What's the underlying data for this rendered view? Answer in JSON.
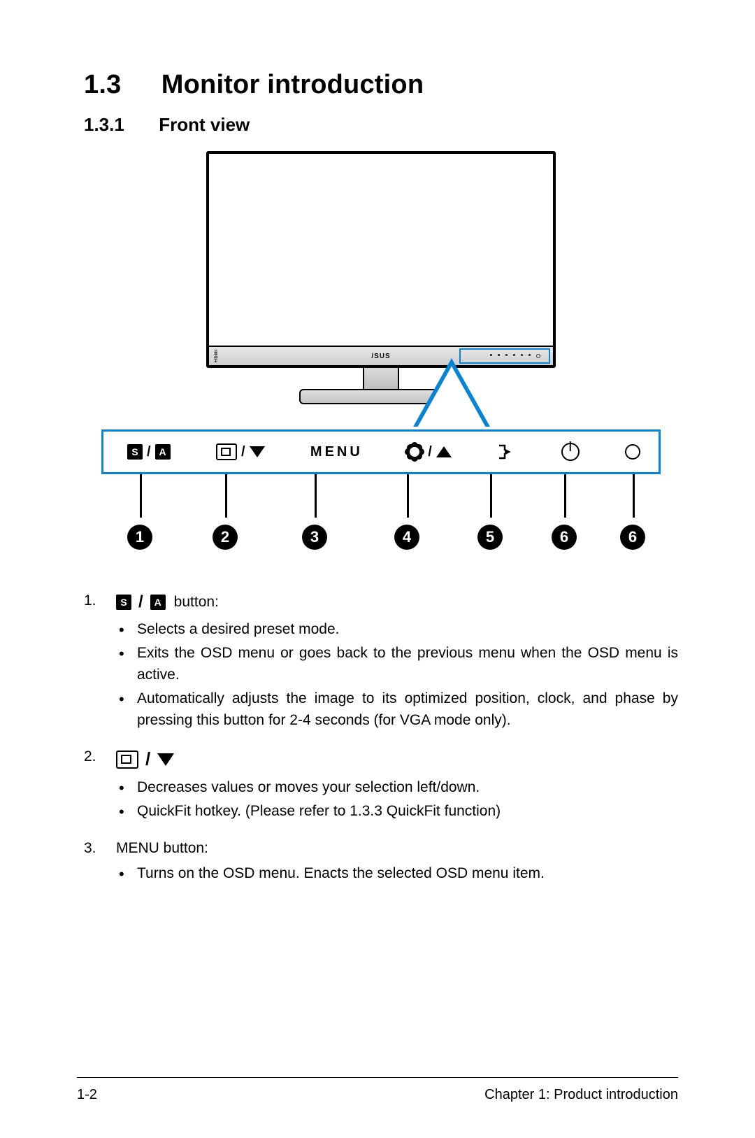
{
  "section": {
    "number": "1.3",
    "title": "Monitor introduction"
  },
  "subsection": {
    "number": "1.3.1",
    "title": "Front view"
  },
  "monitor": {
    "logo_text": "/SUS",
    "port_label": "HDMI"
  },
  "strip": {
    "cell1_s": "S",
    "cell1_a": "A",
    "cell3_menu": "MENU"
  },
  "callouts": [
    "1",
    "2",
    "3",
    "4",
    "5",
    "6",
    "6"
  ],
  "list": {
    "item1": {
      "n": "1.",
      "icon_s": "S",
      "icon_a": "A",
      "head_tail": "button:",
      "b1": "Selects a desired preset mode.",
      "b2": "Exits the OSD menu or goes back to the previous menu when the OSD menu is active.",
      "b3": "Automatically adjusts the image to its optimized position, clock, and phase by pressing this button for 2-4 seconds (for VGA mode only)."
    },
    "item2": {
      "n": "2.",
      "b1": "Decreases values or moves your selection left/down.",
      "b2": "QuickFit hotkey. (Please refer to 1.3.3 QuickFit function)"
    },
    "item3": {
      "n": "3.",
      "head": "MENU button:",
      "b1": "Turns on the OSD menu. Enacts the selected OSD menu item."
    }
  },
  "footer": {
    "left": "1-2",
    "right": "Chapter 1: Product introduction"
  }
}
